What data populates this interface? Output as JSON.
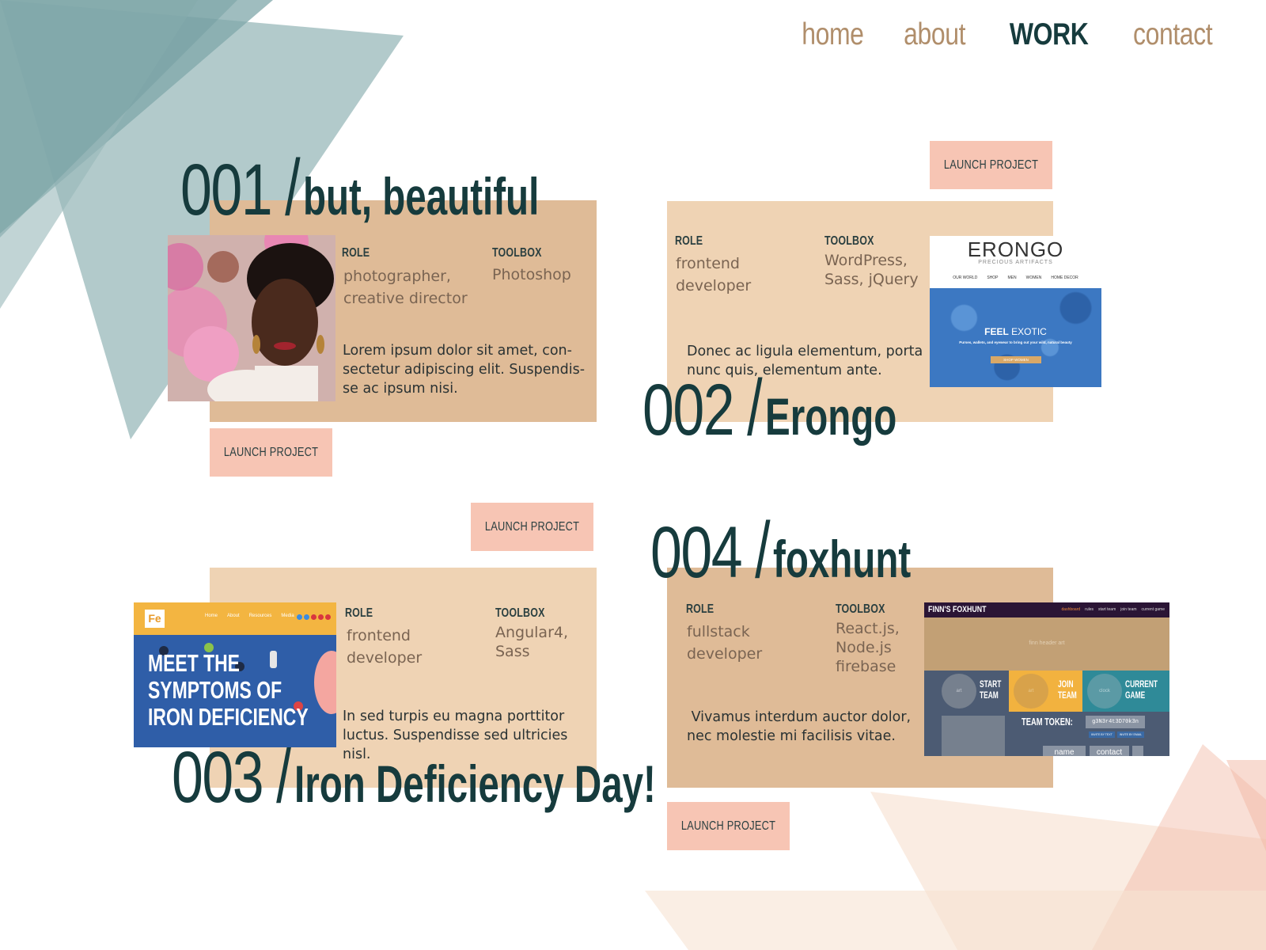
{
  "nav": {
    "items": [
      {
        "label": "home"
      },
      {
        "label": "about"
      },
      {
        "label": "WORK"
      },
      {
        "label": "contact"
      }
    ]
  },
  "labels": {
    "role": "ROLE",
    "toolbox": "TOOLBOX",
    "launch": "LAUNCH PROJECT"
  },
  "projects": [
    {
      "number": "001",
      "title": "but, beautiful",
      "role": [
        "photographer,",
        "creative director"
      ],
      "toolbox": [
        "Photoshop"
      ],
      "description": [
        "Lorem ipsum dolor sit amet, con-",
        "sectetur adipiscing elit. Suspendis-",
        "se ac ipsum nisi."
      ]
    },
    {
      "number": "002",
      "title": "Erongo",
      "role": [
        "frontend",
        "developer"
      ],
      "toolbox": [
        "WordPress,",
        "Sass, jQuery"
      ],
      "description": [
        "Donec ac ligula elementum, porta",
        "nunc quis, elementum ante."
      ],
      "screenshot": {
        "brand": "ERONGO",
        "tagline": "PRECIOUS ARTIFACTS",
        "menu": [
          "OUR WORLD",
          "SHOP",
          "MEN",
          "WOMEN",
          "HOME DECOR"
        ],
        "headline_a": "FEEL",
        "headline_b": "EXOTIC",
        "sub": "Purses, wallets, and eyewear to bring out your wild, natural beauty",
        "cta": "SHOP WOMEN"
      }
    },
    {
      "number": "003",
      "title": "Iron Deficiency Day!",
      "role": [
        "frontend",
        "developer"
      ],
      "toolbox": [
        "Angular4,",
        "Sass"
      ],
      "description": [
        "In sed turpis eu magna porttitor",
        "luctus. Suspendisse sed ultricies",
        "nisl."
      ],
      "screenshot": {
        "logo": "Fe",
        "menu": [
          "Home",
          "About",
          "Resources",
          "Media"
        ],
        "headline": [
          "MEET THE",
          "SYMPTOMS OF",
          "IRON DEFICIENCY"
        ]
      }
    },
    {
      "number": "004",
      "title": "foxhunt",
      "role": [
        "fullstack",
        "developer"
      ],
      "toolbox": [
        "React.js,",
        "Node.js",
        "firebase"
      ],
      "description": [
        " Vivamus interdum auctor dolor,",
        "nec molestie mi facilisis vitae."
      ],
      "screenshot": {
        "brand": "FINN'S FOXHUNT",
        "menu": [
          "dashboard",
          "rules",
          "start team",
          "join team",
          "current game"
        ],
        "header_art": "finn header art",
        "tiles": [
          {
            "circle": "art",
            "label": [
              "START",
              "TEAM"
            ]
          },
          {
            "circle": "art",
            "label": [
              "JOIN",
              "TEAM"
            ]
          },
          {
            "circle": "clock",
            "label": [
              "CURRENT",
              "GAME"
            ]
          }
        ],
        "token_label": "TEAM TOKEN:",
        "token_value": "g3N3r4t3D70k3n",
        "buttons": [
          "INVITE BY TEXT",
          "INVITE BY EMAIL"
        ],
        "fields": [
          "name",
          "contact"
        ]
      }
    }
  ],
  "colors": {
    "dark_teal": "#163b3d",
    "tan": "#dfbb97",
    "peach": "#efd3b4",
    "launch": "#f7c5b4",
    "nav_brown": "#b08e6b"
  }
}
